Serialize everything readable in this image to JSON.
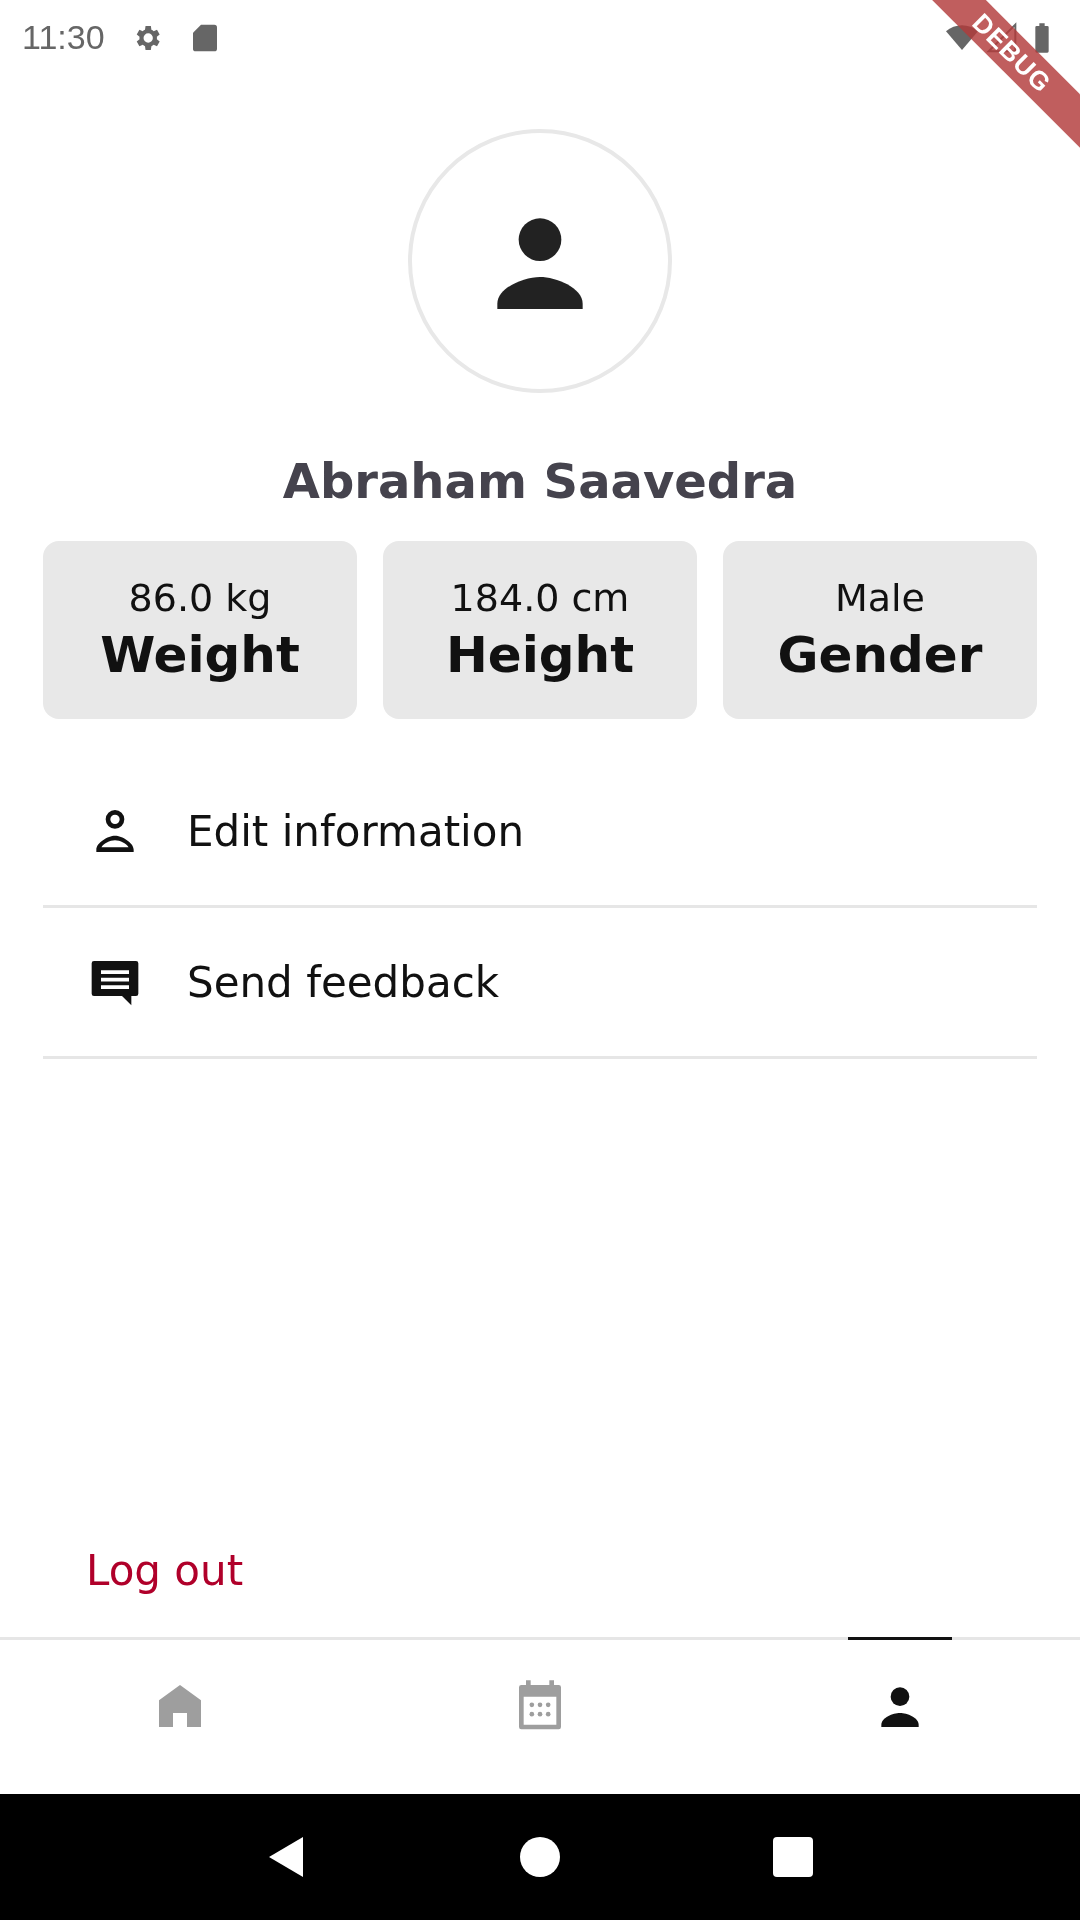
{
  "status_bar": {
    "time": "11:30"
  },
  "debug_banner": "DEBUG",
  "profile": {
    "name": "Abraham Saavedra"
  },
  "stats": [
    {
      "value": "86.0 kg",
      "label": "Weight"
    },
    {
      "value": "184.0 cm",
      "label": "Height"
    },
    {
      "value": "Male",
      "label": "Gender"
    }
  ],
  "menu": [
    {
      "kind": "person",
      "label": "Edit information"
    },
    {
      "kind": "feedback",
      "label": "Send feedback"
    }
  ],
  "logout": "Log out",
  "bottom_nav": [
    {
      "kind": "home",
      "selected": false
    },
    {
      "kind": "calendar",
      "selected": false
    },
    {
      "kind": "profile",
      "selected": true
    }
  ]
}
